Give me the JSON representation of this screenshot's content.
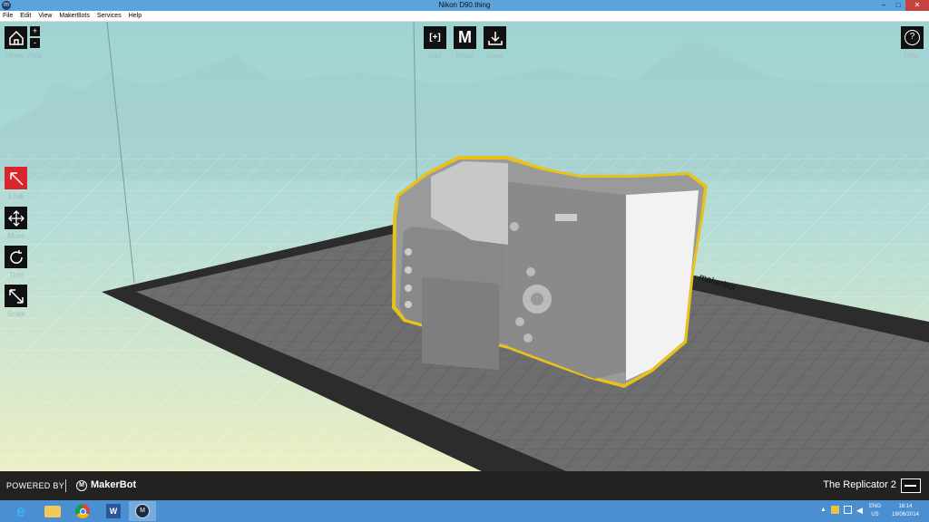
{
  "window": {
    "title": "Nikon D90.thing",
    "minimize": "–",
    "maximize": "□",
    "close": "✕"
  },
  "menu": [
    "File",
    "Edit",
    "View",
    "MakerBots",
    "Services",
    "Help"
  ],
  "toolbar": {
    "home_view": "Home View",
    "zoom_in": "+",
    "zoom_out": "-",
    "add": "Add",
    "add_glyph": "[+]",
    "make": "Make",
    "save": "Save",
    "help": "Help",
    "help_glyph": "?"
  },
  "tools": {
    "look": "Look",
    "move": "Move",
    "turn": "Turn",
    "scale": "Scale"
  },
  "footer": {
    "powered_by": "POWERED BY",
    "brand": "MakerBot",
    "printer": "The Replicator 2"
  },
  "platform_label": "makerbot",
  "tray": {
    "lang1": "ENG",
    "lang2": "US",
    "time": "16:14",
    "date": "19/06/2014"
  },
  "colors": {
    "accent_red": "#d8262e",
    "selection": "#e8c21a",
    "taskbar": "#4a8fd2"
  }
}
